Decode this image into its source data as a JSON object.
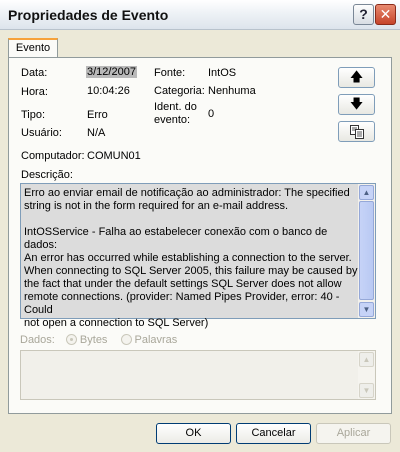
{
  "window": {
    "title": "Propriedades de Evento"
  },
  "tabs": [
    {
      "label": "Evento"
    }
  ],
  "fields": {
    "data_label": "Data:",
    "data_value": "3/12/2007",
    "hora_label": "Hora:",
    "hora_value": "10:04:26",
    "tipo_label": "Tipo:",
    "tipo_value": "Erro",
    "usuario_label": "Usuário:",
    "usuario_value": "N/A",
    "computador_label": "Computador:",
    "computador_value": "COMUN01",
    "fonte_label": "Fonte:",
    "fonte_value": "IntOS",
    "categoria_label": "Categoria:",
    "categoria_value": "Nenhuma",
    "ident_label_line1": "Ident. do",
    "ident_label_line2": "evento:",
    "ident_value": "0"
  },
  "descricao": {
    "label": "Descrição:",
    "text": "Erro ao enviar email de notificação ao administrador: The specified\nstring is not in the form required for an e-mail address.\n\nIntOSService - Falha ao estabelecer conexão com o banco de dados:\nAn error has occurred while establishing a connection to the server.\nWhen connecting to SQL Server 2005, this failure may be caused by\nthe fact that under the default settings SQL Server does not allow\nremote connections. (provider: Named Pipes Provider, error: 40 - Could\nnot open a connection to SQL Server)"
  },
  "dados": {
    "label": "Dados:",
    "option_bytes": "Bytes",
    "option_palavras": "Palavras",
    "selected": "Bytes"
  },
  "buttons": {
    "ok": "OK",
    "cancelar": "Cancelar",
    "aplicar": "Aplicar"
  },
  "icons": {
    "help": "help-icon",
    "close": "close-icon",
    "up": "arrow-up-icon",
    "down": "arrow-down-icon",
    "copy": "copy-icon"
  }
}
